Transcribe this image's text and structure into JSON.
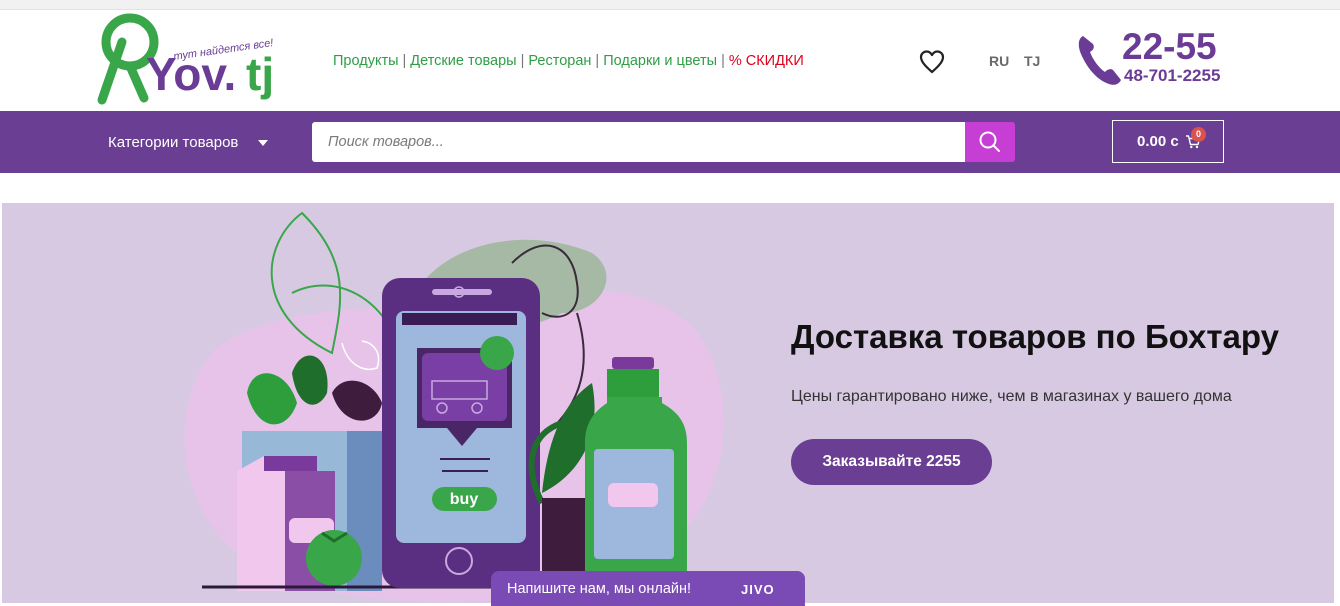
{
  "header": {
    "logo": {
      "text": "Yov.tj",
      "tagline": "тут найдется все!"
    },
    "nav": {
      "items": [
        "Продукты",
        "Детские товары",
        "Ресторан",
        "Подарки и цветы"
      ],
      "separator": "|",
      "sale_label": "% СКИДКИ"
    },
    "wishlist_icon": "heart-outline-icon",
    "languages": [
      "RU",
      "TJ"
    ],
    "phone": {
      "short": "22-55",
      "full": "48-701-2255",
      "icon": "phone-icon"
    }
  },
  "toolbar": {
    "categories_label": "Категории товаров",
    "search_placeholder": "Поиск товаров...",
    "search_icon": "search-icon",
    "cart": {
      "total": "0.00 с",
      "count": "0",
      "icon": "cart-icon"
    }
  },
  "hero": {
    "title": "Доставка товаров по Бохтару",
    "subtitle": "Цены гарантировано ниже, чем в магазинах у вашего дома",
    "button_label": "Заказывайте 2255",
    "illustration": {
      "phone_button_text": "buy"
    }
  },
  "chat": {
    "label": "Напишите нам, мы онлайн!",
    "brand": "JIVO"
  },
  "colors": {
    "brand_purple": "#6a3e93",
    "brand_green": "#2f9e45",
    "sale_red": "#e0001b",
    "search_button": "#c63ed4",
    "hero_background": "#d8c9e3"
  }
}
